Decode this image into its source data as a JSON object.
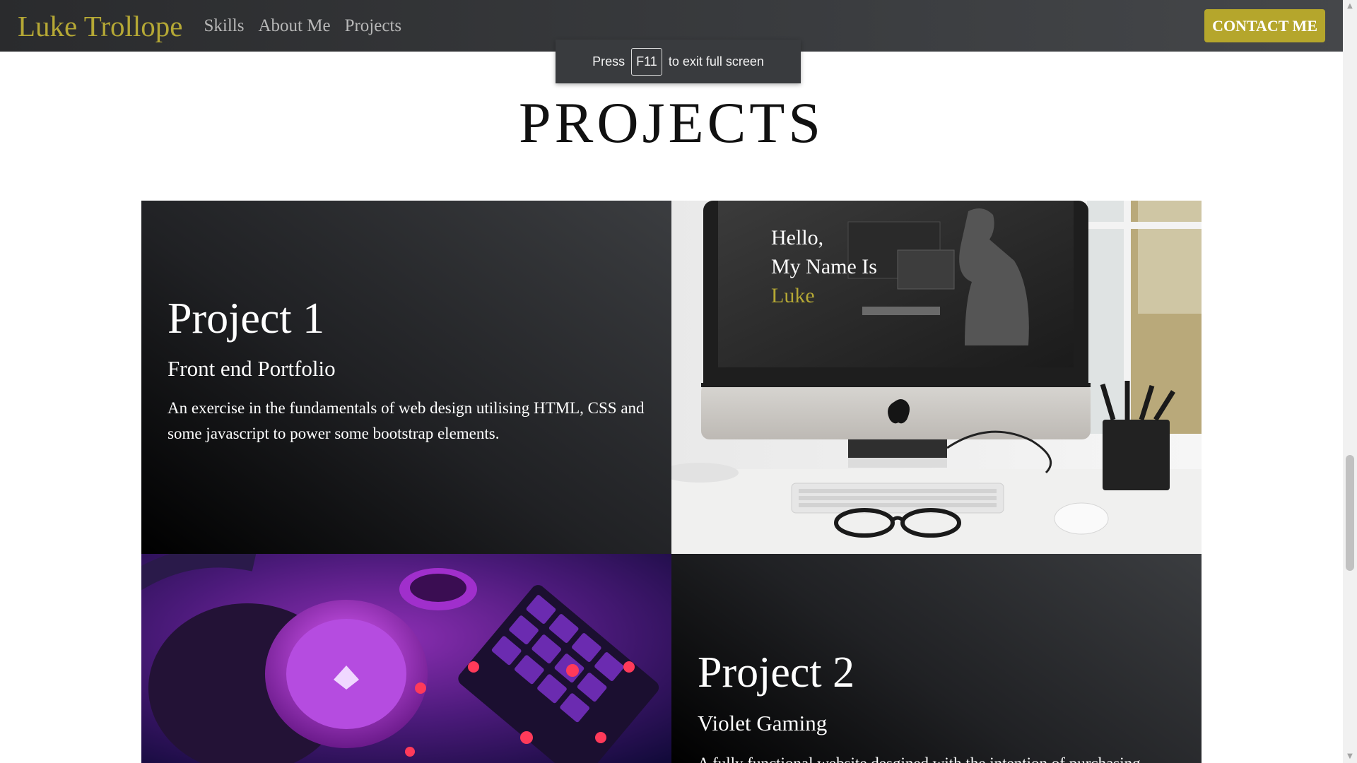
{
  "navbar": {
    "brand": "Luke Trollope",
    "links": [
      "Skills",
      "About Me",
      "Projects"
    ],
    "contact_label": "CONTACT ME"
  },
  "fullscreen_notice": {
    "before": "Press",
    "key": "F11",
    "after": "to exit full screen"
  },
  "section": {
    "title": "PROJECTS"
  },
  "projects": [
    {
      "title": "Project 1",
      "subtitle": "Front end Portfolio",
      "description": "An exercise in the fundamentals of web design utilising HTML, CSS and some javascript to power some bootstrap elements.",
      "image_greeting": [
        "Hello,",
        "My Name Is",
        "Luke"
      ]
    },
    {
      "title": "Project 2",
      "subtitle": "Violet Gaming",
      "description": "A fully functional website desgined with the intention of purchasing"
    }
  ],
  "colors": {
    "accent": "#b5a835",
    "button": "#b5a62c",
    "navbar": "#2a2b2d"
  }
}
